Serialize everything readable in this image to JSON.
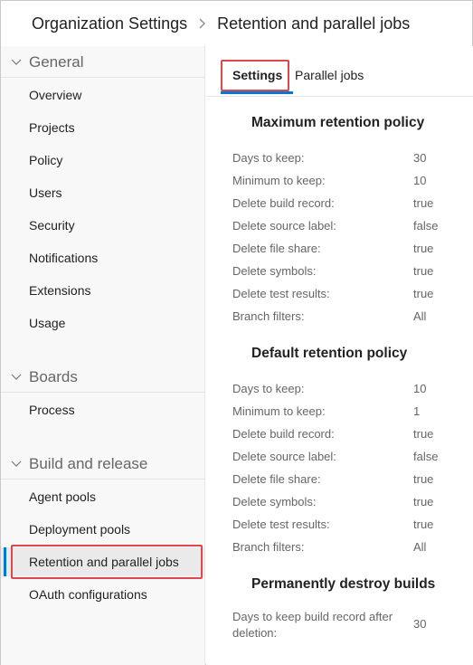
{
  "breadcrumb": {
    "root": "Organization Settings",
    "current": "Retention and parallel jobs"
  },
  "sidebar": {
    "groups": [
      {
        "title": "General",
        "items": [
          "Overview",
          "Projects",
          "Policy",
          "Users",
          "Security",
          "Notifications",
          "Extensions",
          "Usage"
        ]
      },
      {
        "title": "Boards",
        "items": [
          "Process"
        ]
      },
      {
        "title": "Build and release",
        "items": [
          "Agent pools",
          "Deployment pools",
          "Retention and parallel jobs",
          "OAuth configurations"
        ]
      }
    ],
    "selected_item": "Retention and parallel jobs"
  },
  "tabs": [
    {
      "label": "Settings",
      "active": true
    },
    {
      "label": "Parallel jobs",
      "active": false
    }
  ],
  "sections": [
    {
      "title": "Maximum retention policy",
      "rows": [
        {
          "label": "Days to keep:",
          "value": "30"
        },
        {
          "label": "Minimum to keep:",
          "value": "10"
        },
        {
          "label": "Delete build record:",
          "value": "true"
        },
        {
          "label": "Delete source label:",
          "value": "false"
        },
        {
          "label": "Delete file share:",
          "value": "true"
        },
        {
          "label": "Delete symbols:",
          "value": "true"
        },
        {
          "label": "Delete test results:",
          "value": "true"
        },
        {
          "label": "Branch filters:",
          "value": "All"
        }
      ]
    },
    {
      "title": "Default retention policy",
      "rows": [
        {
          "label": "Days to keep:",
          "value": "10"
        },
        {
          "label": "Minimum to keep:",
          "value": "1"
        },
        {
          "label": "Delete build record:",
          "value": "true"
        },
        {
          "label": "Delete source label:",
          "value": "false"
        },
        {
          "label": "Delete file share:",
          "value": "true"
        },
        {
          "label": "Delete symbols:",
          "value": "true"
        },
        {
          "label": "Delete test results:",
          "value": "true"
        },
        {
          "label": "Branch filters:",
          "value": "All"
        }
      ]
    },
    {
      "title": "Permanently destroy builds",
      "rows": [
        {
          "label": "Days to keep build record after deletion:",
          "value": "30"
        }
      ]
    }
  ],
  "colors": {
    "accent": "#0078d4",
    "highlight": "#e0474c"
  },
  "icons": {
    "breadcrumb_separator": "chevron-right-icon",
    "group_toggle": "chevron-down-icon"
  }
}
